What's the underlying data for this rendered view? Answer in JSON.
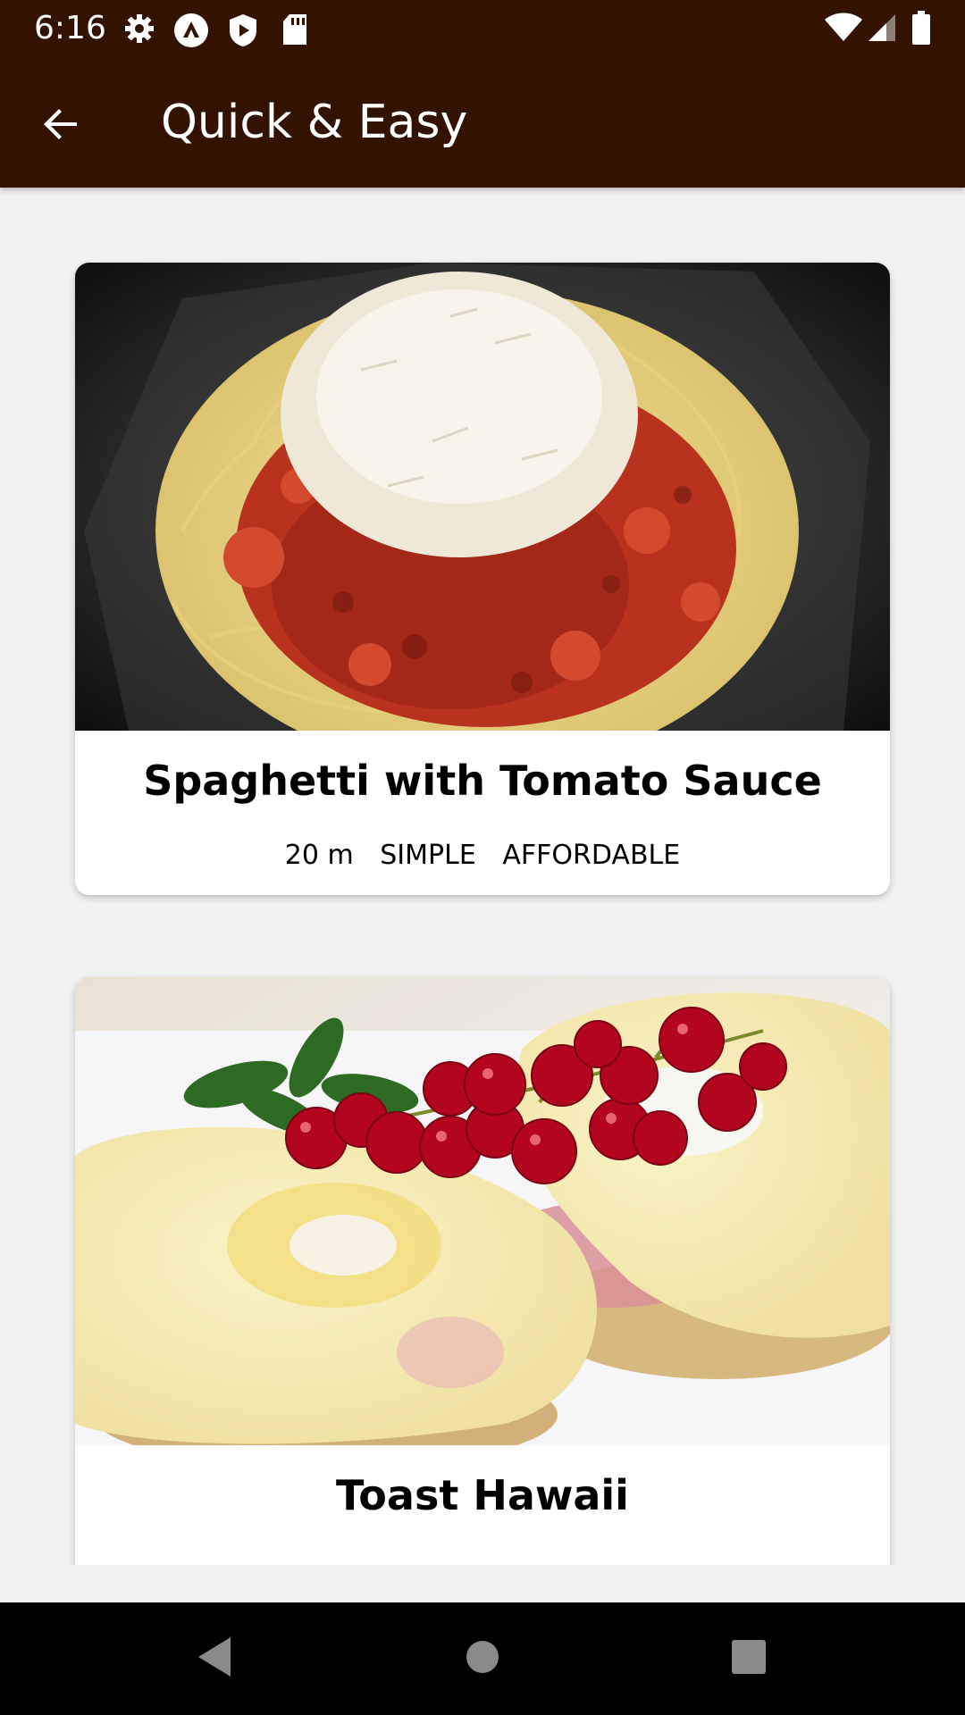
{
  "status_bar": {
    "time": "6:16",
    "icons": [
      "gear-icon",
      "android-auto-icon",
      "shield-play-icon",
      "sd-card-icon",
      "wifi-icon",
      "cellular-signal-icon",
      "battery-icon"
    ]
  },
  "app_bar": {
    "title": "Quick & Easy",
    "back_icon": "arrow-back-icon",
    "background": "#331200"
  },
  "meals": [
    {
      "title": "Spaghetti with Tomato Sauce",
      "duration": "20 m",
      "complexity": "SIMPLE",
      "affordability": "AFFORDABLE"
    },
    {
      "title": "Toast Hawaii"
    }
  ],
  "nav_bar": {
    "icons": [
      "back-triangle-icon",
      "home-circle-icon",
      "recents-square-icon"
    ]
  }
}
